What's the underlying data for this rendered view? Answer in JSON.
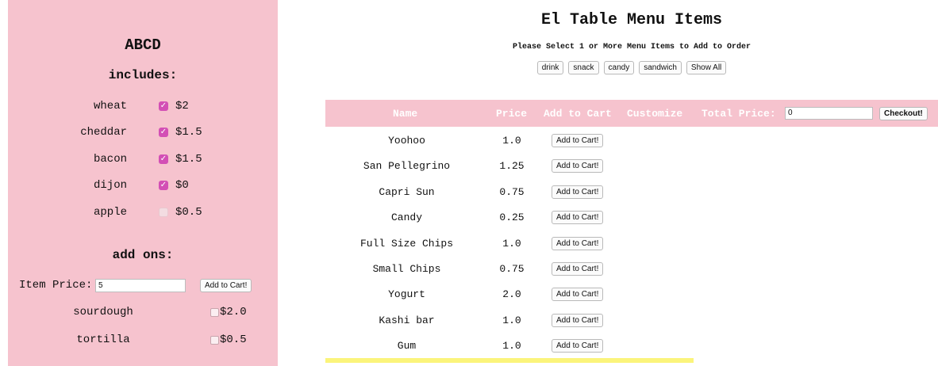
{
  "left_panel": {
    "title": "ABCD",
    "includes_heading": "includes:",
    "includes": [
      {
        "name": "wheat",
        "price": "$2",
        "checked": true
      },
      {
        "name": "cheddar",
        "price": "$1.5",
        "checked": true
      },
      {
        "name": "bacon",
        "price": "$1.5",
        "checked": true
      },
      {
        "name": "dijon",
        "price": "$0",
        "checked": true
      },
      {
        "name": "apple",
        "price": "$0.5",
        "checked": false
      }
    ],
    "addons_heading": "add ons:",
    "item_price_label": "Item Price:",
    "item_price_value": "5",
    "add_to_cart_label": "Add to Cart!",
    "addons": [
      {
        "name": "sourdough",
        "price": "$2.0",
        "checked": false
      },
      {
        "name": "tortilla",
        "price": "$0.5",
        "checked": false
      }
    ]
  },
  "main": {
    "title": "El Table Menu Items",
    "subtitle": "Please Select 1 or More Menu Items to Add to Order",
    "filters": [
      "drink",
      "snack",
      "candy",
      "sandwich",
      "Show All"
    ],
    "table_header": {
      "name": "Name",
      "price": "Price",
      "add_to_cart": "Add to Cart",
      "customize": "Customize",
      "total_price": "Total Price:",
      "total_value": "0",
      "checkout": "Checkout!"
    },
    "row_button_label": "Add to Cart!",
    "items": [
      {
        "name": "Yoohoo",
        "price": "1.0"
      },
      {
        "name": "San Pellegrino",
        "price": "1.25"
      },
      {
        "name": "Capri Sun",
        "price": "0.75"
      },
      {
        "name": "Candy",
        "price": "0.25"
      },
      {
        "name": "Full Size Chips",
        "price": "1.0"
      },
      {
        "name": "Small Chips",
        "price": "0.75"
      },
      {
        "name": "Yogurt",
        "price": "2.0"
      },
      {
        "name": "Kashi bar",
        "price": "1.0"
      },
      {
        "name": "Gum",
        "price": "1.0"
      }
    ]
  },
  "colors": {
    "panel_pink": "#f6c3ce",
    "checkbox_magenta": "#d34fb5",
    "highlight_yellow": "#fbf47b"
  }
}
